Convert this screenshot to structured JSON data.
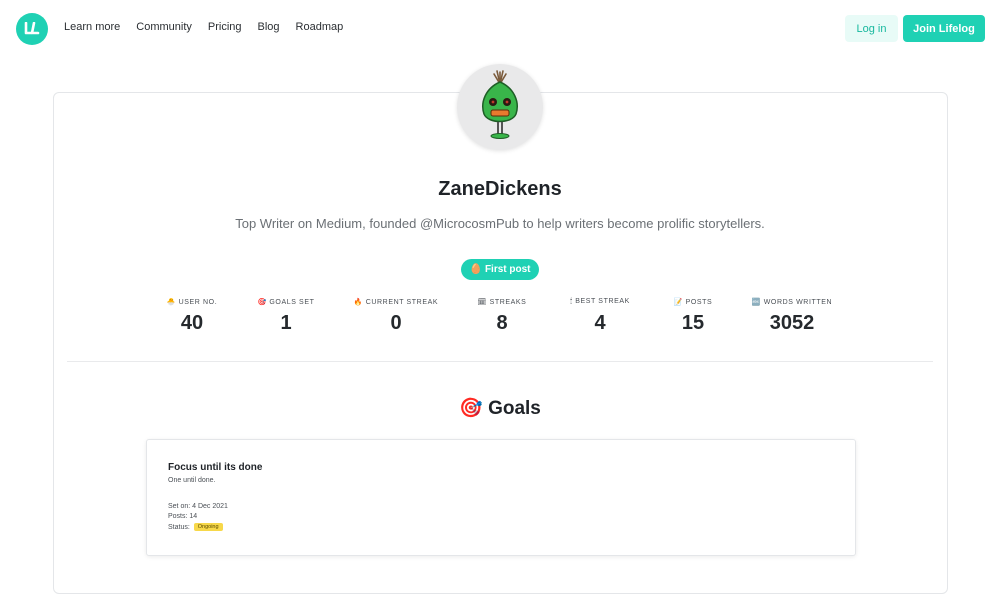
{
  "nav": {
    "links": [
      "Learn more",
      "Community",
      "Pricing",
      "Blog",
      "Roadmap"
    ],
    "login_label": "Log in",
    "join_label": "Join Lifelog"
  },
  "profile": {
    "username": "ZaneDickens",
    "bio": "Top Writer on Medium, founded @MicrocosmPub to help writers become prolific storytellers.",
    "badge_label": "First post"
  },
  "stats": [
    {
      "icon": "🐣",
      "label": "USER NO.",
      "value": "40"
    },
    {
      "icon": "🎯",
      "label": "GOALS SET",
      "value": "1"
    },
    {
      "icon": "🔥",
      "label": "CURRENT STREAK",
      "value": "0"
    },
    {
      "icon": "🗓",
      "label": "STREAKS",
      "value": "8"
    },
    {
      "icon": "🕯",
      "label": "BEST STREAK",
      "value": "4"
    },
    {
      "icon": "📝",
      "label": "POSTS",
      "value": "15"
    },
    {
      "icon": "🔤",
      "label": "WORDS WRITTEN",
      "value": "3052"
    }
  ],
  "goals": {
    "heading": "Goals",
    "items": [
      {
        "title": "Focus until its done",
        "description": "One until done.",
        "set_on": "Set on: 4 Dec 2021",
        "posts": "Posts: 14",
        "status_label": "Status:",
        "status": "Ongoing"
      }
    ]
  },
  "colors": {
    "accent": "#1fd1b4",
    "status": "#f7d84a"
  }
}
